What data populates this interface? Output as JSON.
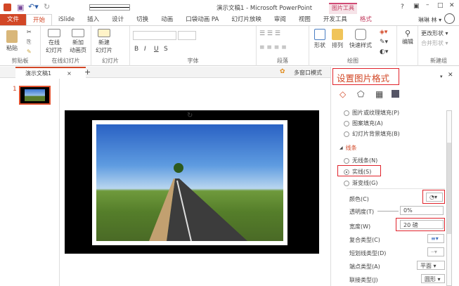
{
  "app": {
    "title": "演示文稿1 - Microsoft PowerPoint",
    "context_tab": "图片工具",
    "help": "?",
    "user": "琳琳 林 ▾"
  },
  "tabs": [
    "文件",
    "开始",
    "iSlide",
    "插入",
    "设计",
    "切换",
    "动画",
    "口袋动画 PA",
    "幻灯片放映",
    "审阅",
    "视图",
    "开发工具",
    "格式"
  ],
  "ribbon": {
    "clipboard": {
      "paste": "粘贴",
      "label": "剪贴板"
    },
    "online": {
      "online_slide": "在线\n幻灯片",
      "new_anim": "新加\n动画页",
      "label": "在线幻灯片"
    },
    "slides": {
      "new_slide": "新建\n幻灯片",
      "label": "幻灯片"
    },
    "font": {
      "bold": "B",
      "italic": "I",
      "underline": "U",
      "strike": "S",
      "label": "字体"
    },
    "paragraph": {
      "label": "段落"
    },
    "drawing": {
      "shape": "形状",
      "arrange": "排列",
      "quick_style": "快速样式",
      "label": "绘图"
    },
    "editing": {
      "edit": "编辑"
    },
    "newgroup": {
      "change_shape": "更改形状 ▾",
      "merge_shape": "合并形状 ▾",
      "label": "新建组"
    }
  },
  "doc_tab": {
    "name": "演示文稿1",
    "multi_window": "多窗口模式"
  },
  "slide_number": "1",
  "pane": {
    "title": "设置图片格式",
    "fill_options": [
      "图片或纹理填充(P)",
      "图案填充(A)",
      "幻灯片背景填充(B)"
    ],
    "line_section": "线条",
    "line_options": [
      {
        "label": "无线条(N)",
        "checked": false
      },
      {
        "label": "实线(S)",
        "checked": true
      },
      {
        "label": "渐变线(G)",
        "checked": false
      }
    ],
    "props": {
      "color": "颜色(C)",
      "transparency": "透明度(T)",
      "transparency_value": "0%",
      "width": "宽度(W)",
      "width_value": "20 磅",
      "compound": "复合类型(C)",
      "dash": "短划线类型(D)",
      "cap": "端点类型(A)",
      "cap_value": "平面",
      "join": "联接类型(J)",
      "join_value": "圆形"
    }
  }
}
